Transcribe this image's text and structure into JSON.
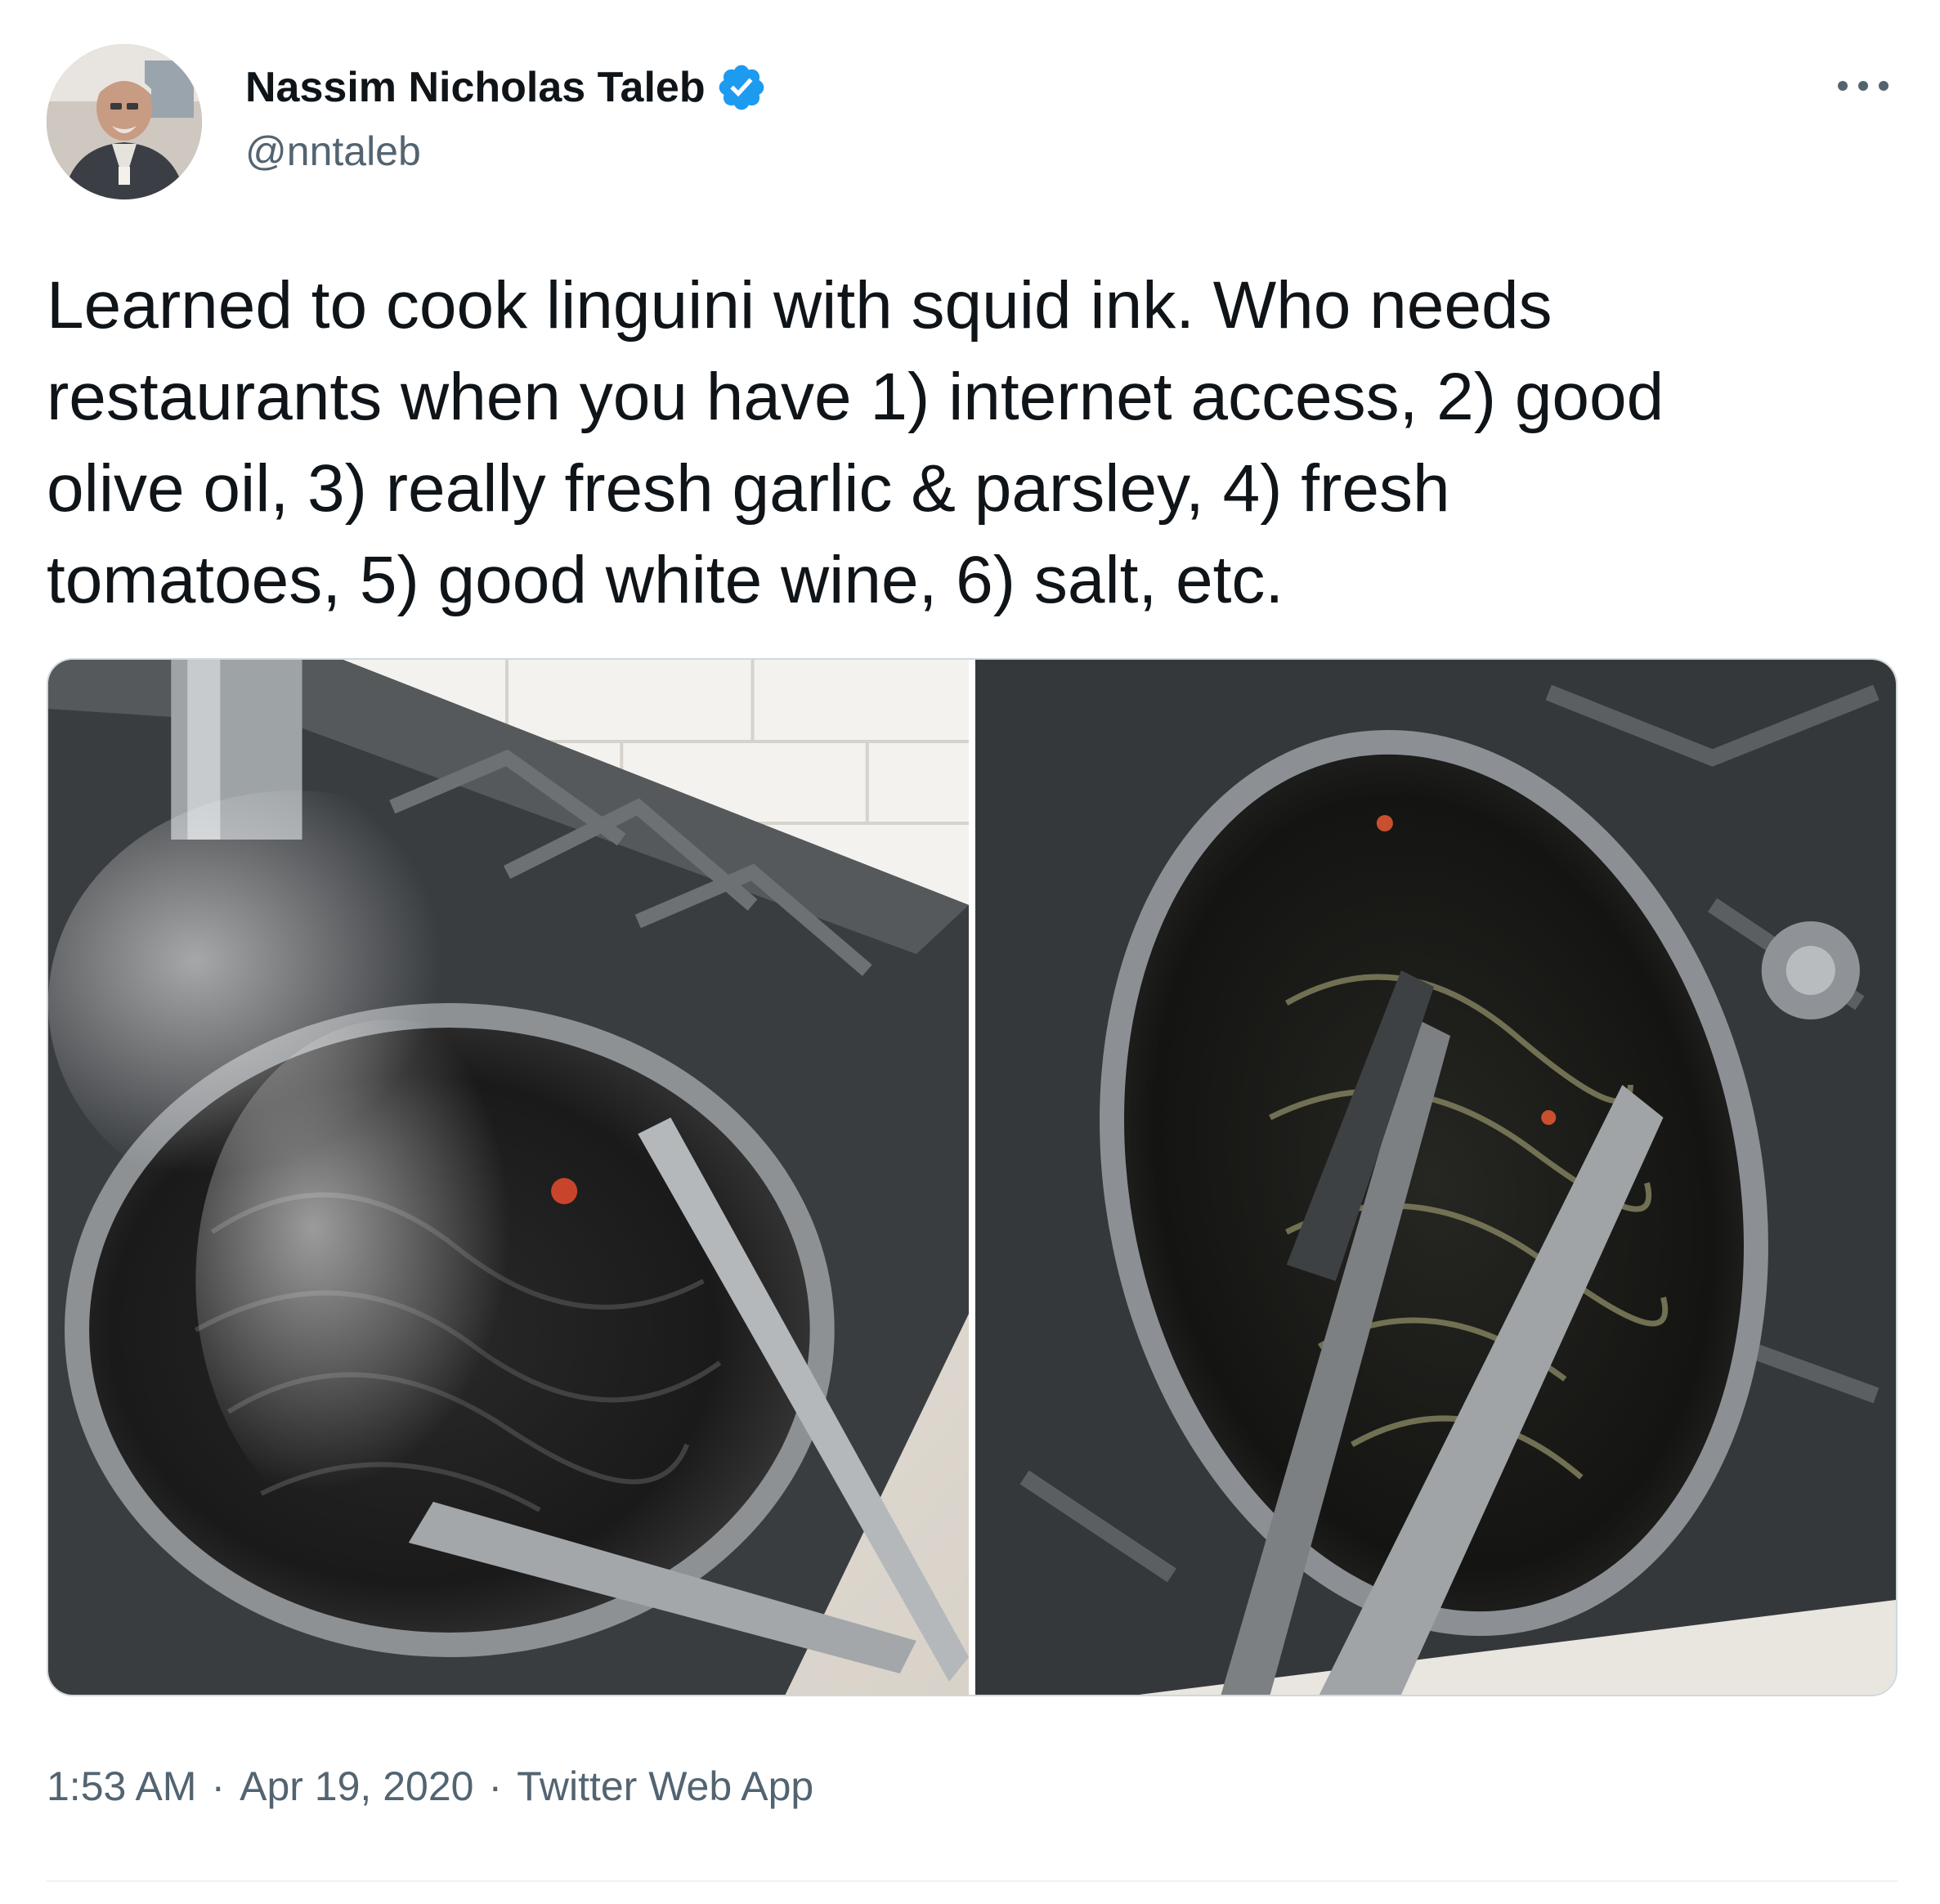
{
  "author": {
    "display_name": "Nassim Nicholas Taleb",
    "handle": "@nntaleb",
    "verified": true,
    "avatar_icon": "profile-photo"
  },
  "tweet": {
    "text": "Learned to cook linguini with squid ink. Who needs\nrestaurants when you have 1) internet access, 2) good\nolive oil, 3) really fresh garlic & parsley, 4) fresh\ntomatoes, 5) good white wine, 6) salt, etc.",
    "media_count": 2
  },
  "meta": {
    "time": "1:53 AM",
    "separator": "·",
    "date": "Apr 19, 2020",
    "source": "Twitter Web App"
  },
  "icons": {
    "more": "more-options-icon",
    "verified": "verified-badge-icon"
  },
  "colors": {
    "text_primary": "#0f1419",
    "text_secondary": "#536471",
    "verified_blue": "#1d9bf0",
    "border": "#cfd9de"
  }
}
